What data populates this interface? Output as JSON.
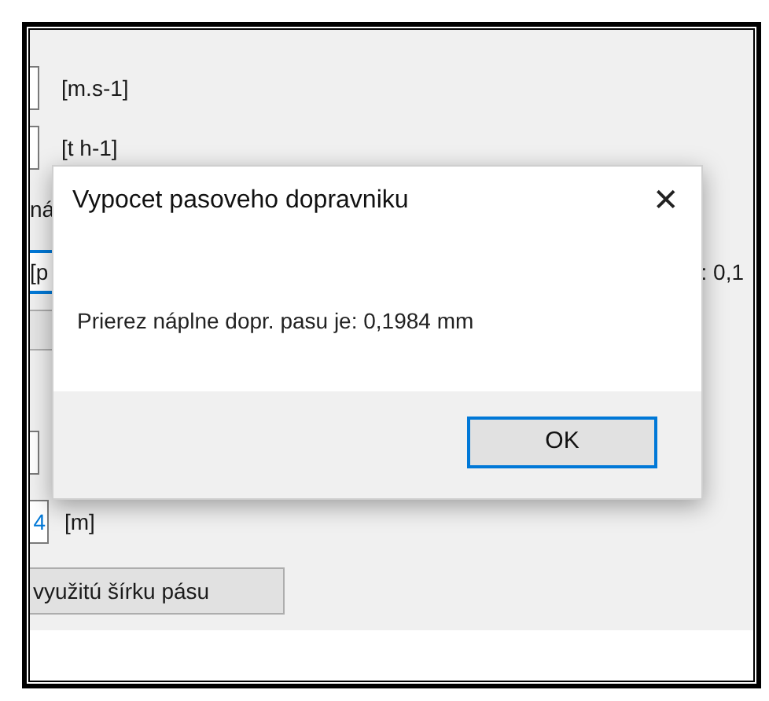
{
  "background_form": {
    "speed_unit": "[m.s-1]",
    "flow_unit": "[t h-1]",
    "label_fragment": "ná",
    "field_fragment": "[p",
    "result_fragment": ": 0,1",
    "length_value": "4",
    "length_unit": "[m]",
    "button": "využitú šírku pásu"
  },
  "dialog": {
    "title": "Vypocet pasoveho dopravniku",
    "close": "✕",
    "message": "Prierez náplne dopr. pasu je: 0,1984 mm",
    "ok_button": "OK"
  }
}
